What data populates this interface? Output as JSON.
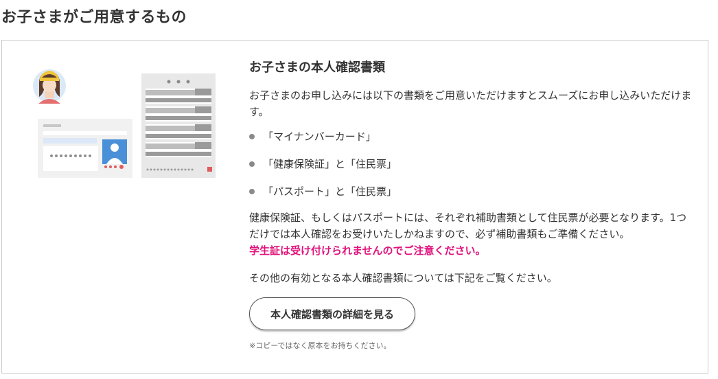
{
  "section": {
    "title": "お子さまがご用意するもの"
  },
  "card": {
    "title": "お子さまの本人確認書類",
    "lead": "お子さまのお申し込みには以下の書類をご用意いただけますとスムーズにお申し込みいただけます。",
    "documents": [
      "「マイナンバーカード」",
      "「健康保険証」と「住民票」",
      "「パスポート」と「住民票」"
    ],
    "note": "健康保険証、もしくはパスポートには、それぞれ補助書類として住民票が必要となります。1つだけでは本人確認をお受けいたしかねますので、必ず補助書類もご準備ください。",
    "warning": "学生証は受け付けられませんのでご注意ください。",
    "other": "その他の有効となる本人確認書類については下記をご覧ください。",
    "button_label": "本人確認書類の詳細を見る",
    "footnote": "※コピーではなく原本をお持ちください。"
  },
  "colors": {
    "warning": "#e1127c",
    "border": "#c9c9c9",
    "bullet": "#8a8a8a"
  },
  "icons": {
    "illustration": "id-documents-illustration"
  }
}
